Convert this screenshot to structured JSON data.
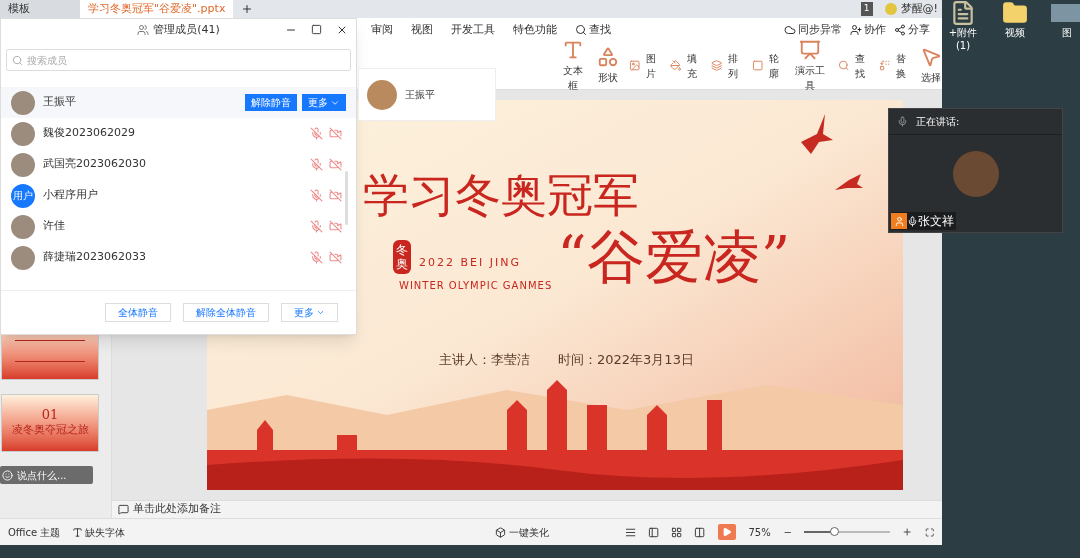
{
  "window_tabs": [
    {
      "label": "模板",
      "selected": false
    },
    {
      "label": "学习冬奥冠军\"谷爱凌\".pptx",
      "selected": true
    }
  ],
  "notification_count": "1",
  "user_name": "梦醒@!",
  "ribbon_tabs": [
    {
      "label": "审阅",
      "selected": false
    },
    {
      "label": "视图",
      "selected": false
    },
    {
      "label": "开发工具",
      "selected": false
    },
    {
      "label": "特色功能",
      "selected": false
    },
    {
      "label": "查找",
      "selected": false
    }
  ],
  "ribbon_actions": [
    "同步异常",
    "协作",
    "分享"
  ],
  "ribbon_tools": [
    {
      "label": "文本框",
      "kind": "large"
    },
    {
      "label": "形状",
      "kind": "large"
    },
    {
      "label": "图片",
      "kind": "small"
    },
    {
      "label": "填充",
      "kind": "small"
    },
    {
      "label": "排列",
      "kind": "small"
    },
    {
      "label": "轮廓",
      "kind": "small"
    },
    {
      "label": "演示工具",
      "kind": "large"
    },
    {
      "label": "查找",
      "kind": "small"
    },
    {
      "label": "替换",
      "kind": "small"
    },
    {
      "label": "选择",
      "kind": "large"
    }
  ],
  "thumbnails": [
    {
      "kind": "agenda",
      "selected": false
    },
    {
      "kind": "section",
      "number": "01",
      "title": "凌冬奥夺冠之旅",
      "selected": false
    }
  ],
  "chat_placeholder": "说点什么...",
  "slide": {
    "title": "学习冬奥冠军",
    "seal": "冬奥",
    "line1": "2022 BEI JING",
    "line2": "WINTER OLYMPIC GANMES",
    "name": "“谷爱凌”",
    "presenter": "主讲人：李莹洁",
    "date": "时间：2022年3月13日"
  },
  "notes_placeholder": "单击此处添加备注",
  "status_bar": {
    "theme": "Office 主题",
    "missing_font": "缺失字体",
    "beautify": "一键美化",
    "zoom": "75%",
    "zoom_slider": {
      "level": 0.35
    }
  },
  "desktop_icons": [
    {
      "label": "+附件\n(1)",
      "kind": "file"
    },
    {
      "label": "视频",
      "kind": "folder"
    },
    {
      "label": "图",
      "kind": "image"
    }
  ],
  "members_panel": {
    "title": "管理成员(41)",
    "search_placeholder": "搜索成员",
    "members": [
      {
        "name": "王振平",
        "kind": "photo",
        "hovered": true
      },
      {
        "name": "魏俊2023062029",
        "kind": "photo",
        "hovered": false,
        "mic_muted": true,
        "camera_off": true
      },
      {
        "name": "武国亮2023062030",
        "kind": "photo",
        "hovered": false,
        "mic_muted": true,
        "camera_off": true
      },
      {
        "name": "小程序用户",
        "kind": "text",
        "avatar_text": "用户",
        "hovered": false,
        "mic_muted": true,
        "camera_off": true
      },
      {
        "name": "许佳",
        "kind": "photo",
        "hovered": false,
        "mic_muted": true,
        "camera_off": true
      },
      {
        "name": "薛捷瑞2023062033",
        "kind": "photo",
        "hovered": false,
        "mic_muted": true,
        "camera_off": true
      }
    ],
    "row_buttons": [
      "解除静音",
      "更多"
    ],
    "footer_buttons": [
      {
        "label": "全体静音",
        "dropdown": false
      },
      {
        "label": "解除全体静音",
        "dropdown": false
      },
      {
        "label": "更多",
        "dropdown": true
      }
    ]
  },
  "hover_card": {
    "name": "王振平"
  },
  "speaking_window": {
    "label": "正在讲话:",
    "speaker": "张文祥"
  }
}
